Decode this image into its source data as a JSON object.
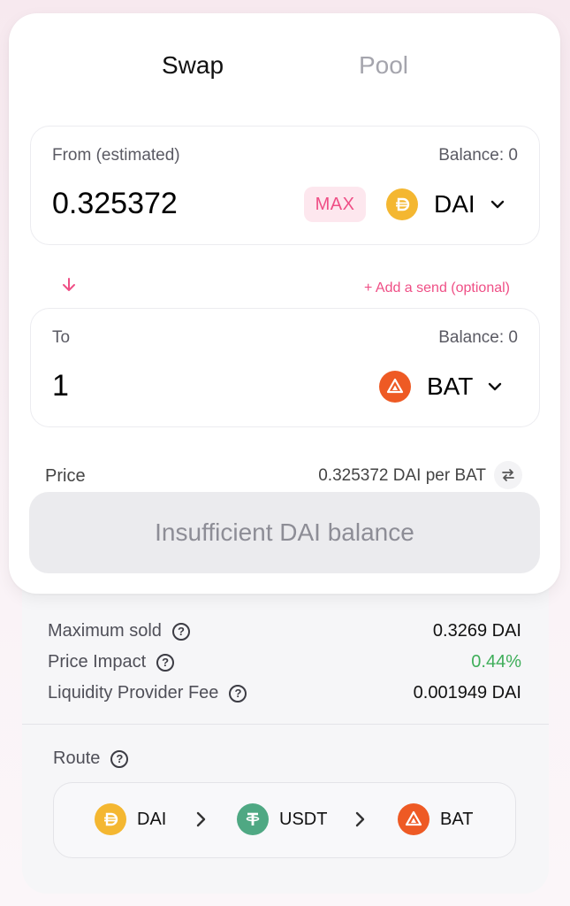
{
  "tabs": {
    "swap": "Swap",
    "pool": "Pool"
  },
  "from": {
    "label": "From (estimated)",
    "balance": "Balance: 0",
    "amount": "0.325372",
    "max_label": "MAX",
    "token": "DAI",
    "token_icon": "dai-coin-icon"
  },
  "to": {
    "label": "To",
    "balance": "Balance: 0",
    "amount": "1",
    "token": "BAT",
    "token_icon": "bat-coin-icon"
  },
  "add_send": "+ Add a send (optional)",
  "price": {
    "label": "Price",
    "value": "0.325372 DAI per BAT"
  },
  "action_button": "Insufficient DAI balance",
  "details": [
    {
      "label": "Maximum sold",
      "value": "0.3269 DAI",
      "color": "#111111"
    },
    {
      "label": "Price Impact",
      "value": "0.44%",
      "color": "#3fae5a"
    },
    {
      "label": "Liquidity Provider Fee",
      "value": "0.001949 DAI",
      "color": "#111111"
    }
  ],
  "route": {
    "label": "Route",
    "hops": [
      {
        "symbol": "DAI",
        "icon": "dai-coin-icon"
      },
      {
        "symbol": "USDT",
        "icon": "usdt-coin-icon"
      },
      {
        "symbol": "BAT",
        "icon": "bat-coin-icon"
      }
    ]
  },
  "colors": {
    "accent": "#ef4f86",
    "dai": "#f4b731",
    "bat": "#ee5a24",
    "usdt": "#4fa883",
    "positive": "#3fae5a",
    "disabled_button": "#ebebee"
  }
}
